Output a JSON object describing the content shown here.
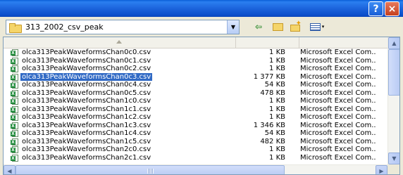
{
  "titlebar": {
    "help_label": "?",
    "close_label": "×"
  },
  "toolbar": {
    "look_in": "313_2002_csv_peak",
    "dropdown_glyph": "▼",
    "back_glyph": "⇦",
    "new_folder_glyph": "✦",
    "views_arrow": "▾"
  },
  "scrollbars": {
    "up": "▲",
    "down": "▼",
    "left": "◀",
    "right": "▶"
  },
  "files": [
    {
      "name": "olca313PeakWaveformsChan0c0.csv",
      "size": "1 KB",
      "type": "Microsoft Excel Com.."
    },
    {
      "name": "olca313PeakWaveformsChan0c1.csv",
      "size": "1 KB",
      "type": "Microsoft Excel Com.."
    },
    {
      "name": "olca313PeakWaveformsChan0c2.csv",
      "size": "1 KB",
      "type": "Microsoft Excel Com.."
    },
    {
      "name": "olca313PeakWaveformsChan0c3.csv",
      "size": "1 377 KB",
      "type": "Microsoft Excel Com.."
    },
    {
      "name": "olca313PeakWaveformsChan0c4.csv",
      "size": "54 KB",
      "type": "Microsoft Excel Com.."
    },
    {
      "name": "olca313PeakWaveformsChan0c5.csv",
      "size": "478 KB",
      "type": "Microsoft Excel Com.."
    },
    {
      "name": "olca313PeakWaveformsChan1c0.csv",
      "size": "1 KB",
      "type": "Microsoft Excel Com.."
    },
    {
      "name": "olca313PeakWaveformsChan1c1.csv",
      "size": "1 KB",
      "type": "Microsoft Excel Com.."
    },
    {
      "name": "olca313PeakWaveformsChan1c2.csv",
      "size": "1 KB",
      "type": "Microsoft Excel Com.."
    },
    {
      "name": "olca313PeakWaveformsChan1c3.csv",
      "size": "1 346 KB",
      "type": "Microsoft Excel Com.."
    },
    {
      "name": "olca313PeakWaveformsChan1c4.csv",
      "size": "54 KB",
      "type": "Microsoft Excel Com.."
    },
    {
      "name": "olca313PeakWaveformsChan1c5.csv",
      "size": "482 KB",
      "type": "Microsoft Excel Com.."
    },
    {
      "name": "olca313PeakWaveformsChan2c0.csv",
      "size": "1 KB",
      "type": "Microsoft Excel Com.."
    },
    {
      "name": "olca313PeakWaveformsChan2c1.csv",
      "size": "1 KB",
      "type": "Microsoft Excel Com.."
    }
  ],
  "selected_index": 3
}
